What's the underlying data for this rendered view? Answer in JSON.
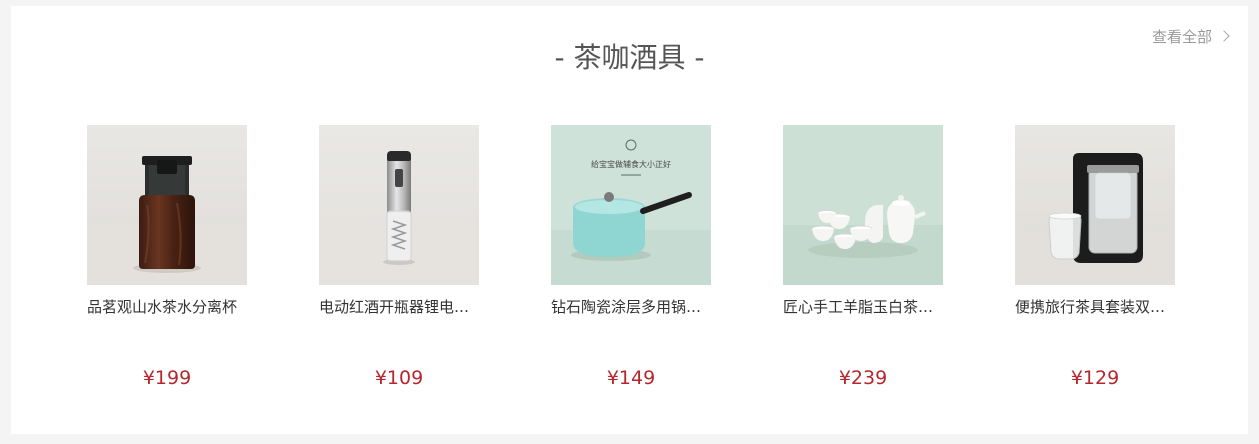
{
  "section": {
    "title": "- 茶咖酒具 -",
    "view_all_label": "查看全部"
  },
  "products": [
    {
      "name": "品茗观山水茶水分离杯",
      "price": "¥199",
      "image": "tea-infuser-cup"
    },
    {
      "name": "电动红酒开瓶器锂电池款",
      "price": "¥109",
      "image": "electric-wine-opener"
    },
    {
      "name": "钻石陶瓷涂层多用锅辅食锅",
      "price": "¥149",
      "image": "ceramic-saucepan"
    },
    {
      "name": "匠心手工羊脂玉白茶具套装",
      "price": "¥239",
      "image": "white-jade-tea-set"
    },
    {
      "name": "便携旅行茶具套装双层杯",
      "price": "¥129",
      "image": "travel-tea-set"
    }
  ],
  "poster": {
    "caption": "给宝宝做辅食大小正好"
  },
  "colors": {
    "price": "#b4282d",
    "background": "#f4f4f4",
    "panel": "#ffffff"
  }
}
